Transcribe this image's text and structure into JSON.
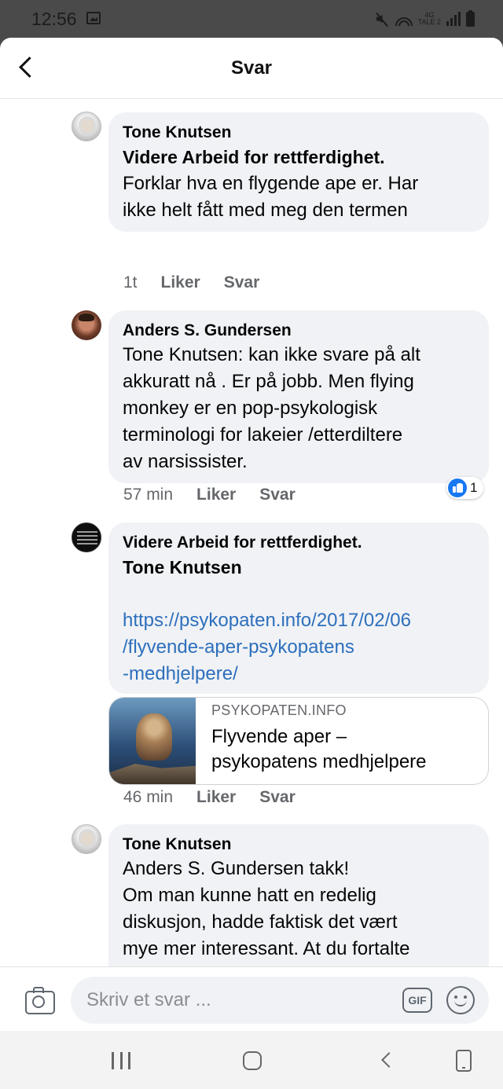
{
  "status_bar": {
    "time": "12:56",
    "network": "4G",
    "carrier": "TALE 2"
  },
  "header": {
    "title": "Svar"
  },
  "comments": [
    {
      "author": "Tone Knutsen",
      "mention": "Videre Arbeid for rettferdighet.",
      "text": "Forklar hva en flygende ape er. Har\nikke helt fått med meg den termen",
      "time": "1t",
      "like_label": "Liker",
      "reply_label": "Svar"
    },
    {
      "author": "Anders S. Gundersen",
      "text": "Tone Knutsen: kan ikke svare på alt\nakkuratt nå . Er på jobb. Men flying\nmonkey er en pop-psykologisk\nterminologi for lakeier /etterdiltere\nav narsissister.",
      "time": "57 min",
      "like_label": "Liker",
      "reply_label": "Svar",
      "reaction_count": "1"
    },
    {
      "author": "Videre Arbeid for rettferdighet.",
      "mention": "Tone Knutsen",
      "link": "https://psykopaten.info/2017/02/06\n/flyvende-aper-psykopatens\n-medhjelpere/",
      "preview": {
        "domain": "PSYKOPATEN.INFO",
        "title": "Flyvende aper –\npsykopatens medhjelpere"
      },
      "time": "46 min",
      "like_label": "Liker",
      "reply_label": "Svar"
    },
    {
      "author": "Tone Knutsen",
      "text": "Anders S. Gundersen takk!\nOm man kunne hatt en redelig\ndiskusjon, hadde faktisk det vært\nmye mer interessant. At du fortalte\nlitt mer om dine studier, og hva du\nhar funnet, og vi kunne sagt noe om"
    }
  ],
  "composer": {
    "placeholder": "Skriv et svar ...",
    "gif_label": "GIF"
  }
}
